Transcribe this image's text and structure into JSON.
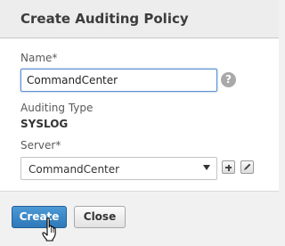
{
  "dialog": {
    "title": "Create Auditing Policy"
  },
  "form": {
    "name_label": "Name*",
    "name_value": "CommandCenter",
    "help_icon": "help-icon",
    "help_glyph": "?",
    "auditing_type_label": "Auditing Type",
    "auditing_type_value": "SYSLOG",
    "server_label": "Server*",
    "server_selected": "CommandCenter",
    "server_add_icon": "plus-icon",
    "server_edit_icon": "pencil-icon"
  },
  "footer": {
    "create_label": "Create",
    "close_label": "Close"
  },
  "colors": {
    "primary_button": "#3585c6",
    "input_focus_border": "#5a8fd1"
  }
}
